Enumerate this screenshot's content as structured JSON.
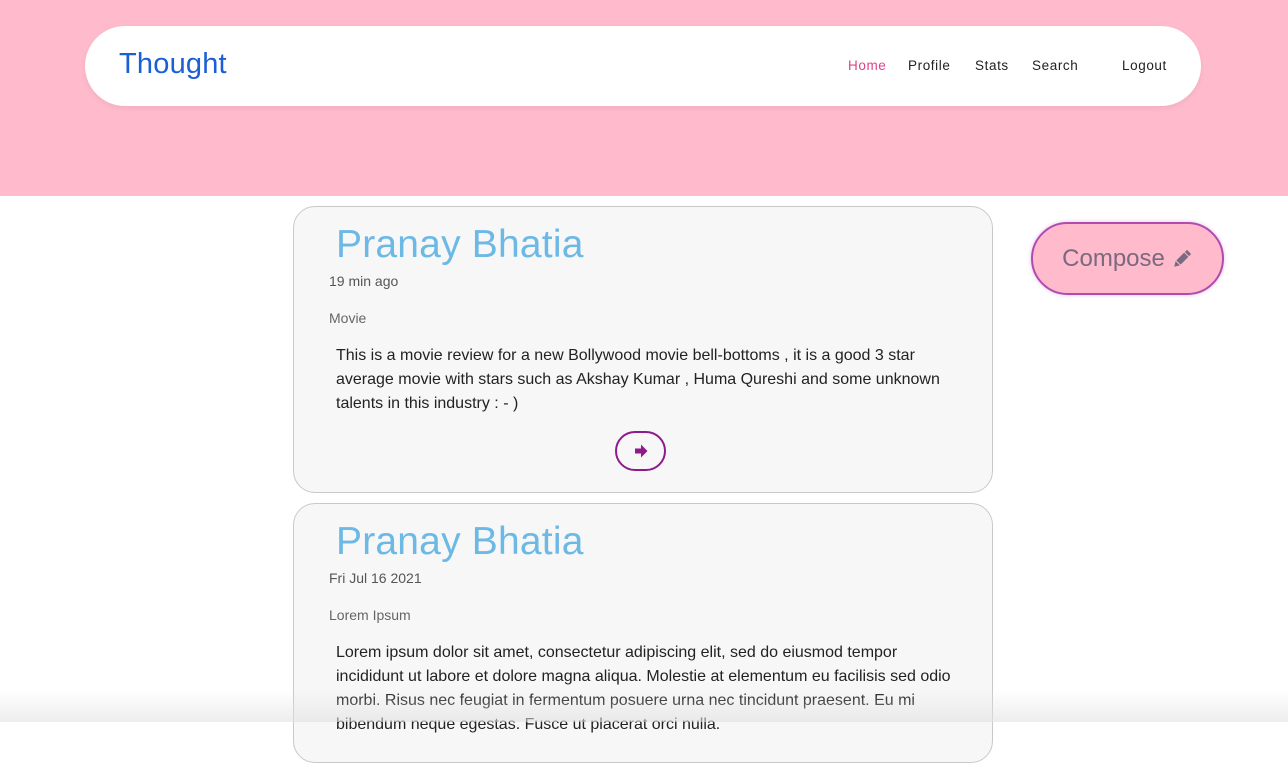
{
  "nav": {
    "brand": "Thought",
    "links": [
      {
        "label": "Home",
        "active": true
      },
      {
        "label": "Profile",
        "active": false
      },
      {
        "label": "Stats",
        "active": false
      },
      {
        "label": "Search",
        "active": false
      },
      {
        "label": "Logout",
        "active": false
      }
    ]
  },
  "compose": {
    "label": "Compose",
    "icon": "pencil-icon"
  },
  "posts": [
    {
      "author": "Pranay Bhatia",
      "date": "19 min ago",
      "category": "Movie",
      "body": "This is a movie review for a new Bollywood movie bell-bottoms , it is a good 3 star average movie with stars such as Akshay Kumar , Huma Qureshi and some unknown talents in this industry : - )",
      "read_icon": "arrow-right-icon"
    },
    {
      "author": "Pranay Bhatia",
      "date": "Fri Jul 16 2021",
      "category": "Lorem Ipsum",
      "body": "Lorem ipsum dolor sit amet, consectetur adipiscing elit, sed do eiusmod tempor incididunt ut labore et dolore magna aliqua. Molestie at elementum eu facilisis sed odio morbi. Risus nec feugiat in fermentum posuere urna nec tincidunt praesent. Eu mi bibendum neque egestas. Fusce ut placerat orci nulla."
    }
  ],
  "colors": {
    "hero": "#ffbacb",
    "brand": "#1a5fd6",
    "active_link": "#e0428a",
    "author": "#6cb9e6",
    "button_border": "#8e1a8e"
  }
}
